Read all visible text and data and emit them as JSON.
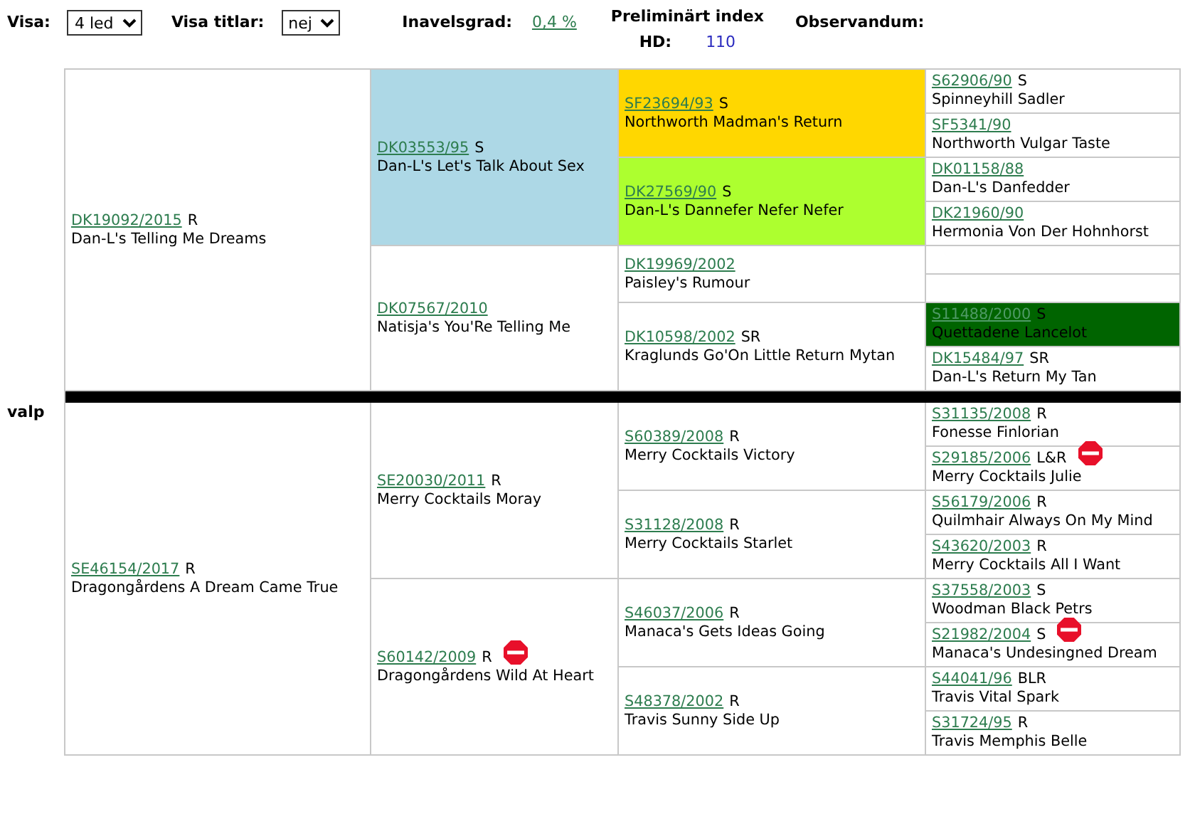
{
  "toolbar": {
    "show_label": "Visa:",
    "show_value": "4 led",
    "titles_label": "Visa titlar:",
    "titles_value": "nej",
    "inbreeding_label": "Inavelsgrad:",
    "inbreeding_value": "0,4 %",
    "index_label": "Preliminärt index",
    "hd_label": "HD:",
    "hd_value": "110",
    "observandum_label": "Observandum:"
  },
  "pedigree": {
    "label": "valp",
    "halves": [
      {
        "kind": "dog",
        "reg": "DK19092/2015",
        "title": "R",
        "name": "Dan-L's Telling Me Dreams",
        "stop": false,
        "children": [
          {
            "kind": "dog",
            "reg": "DK03553/95",
            "title": "S",
            "name": "Dan-L's Let's Talk About Sex",
            "stop": false,
            "color": "#add8e6",
            "children": [
              {
                "kind": "dog",
                "reg": "SF23694/93",
                "title": "S",
                "name": "Northworth Madman's Return",
                "stop": false,
                "color": "#ffd700",
                "children": [
                  {
                    "kind": "dog",
                    "reg": "S62906/90",
                    "title": "S",
                    "name": "Spinneyhill Sadler",
                    "stop": false
                  },
                  {
                    "kind": "dog",
                    "reg": "SF5341/90",
                    "name": "Northworth Vulgar Taste",
                    "stop": false
                  }
                ]
              },
              {
                "kind": "dog",
                "reg": "DK27569/90",
                "title": "S",
                "name": "Dan-L's Dannefer Nefer Nefer",
                "stop": false,
                "color": "#adff2f",
                "children": [
                  {
                    "kind": "dog",
                    "reg": "DK01158/88",
                    "name": "Dan-L's Danfedder",
                    "stop": false
                  },
                  {
                    "kind": "dog",
                    "reg": "DK21960/90",
                    "name": "Hermonia Von Der Hohnhorst",
                    "stop": false
                  }
                ]
              }
            ]
          },
          {
            "kind": "dog",
            "reg": "DK07567/2010",
            "name": "Natisja's You'Re Telling Me",
            "stop": false,
            "children": [
              {
                "kind": "dog",
                "reg": "DK19969/2002",
                "name": "Paisley's Rumour",
                "stop": false,
                "children": [
                  {
                    "kind": "empty"
                  },
                  {
                    "kind": "empty"
                  }
                ]
              },
              {
                "kind": "dog",
                "reg": "DK10598/2002",
                "title": "SR",
                "name": "Kraglunds Go'On Little Return Mytan",
                "stop": false,
                "children": [
                  {
                    "kind": "dog",
                    "reg": "S11488/2000",
                    "title": "S",
                    "name": "Quettadene Lancelot",
                    "stop": false,
                    "color": "#006400"
                  },
                  {
                    "kind": "dog",
                    "reg": "DK15484/97",
                    "title": "SR",
                    "name": "Dan-L's Return My Tan",
                    "stop": false
                  }
                ]
              }
            ]
          }
        ]
      },
      {
        "kind": "dog",
        "reg": "SE46154/2017",
        "title": "R",
        "name": "Dragongårdens A Dream Came True",
        "stop": false,
        "children": [
          {
            "kind": "dog",
            "reg": "SE20030/2011",
            "title": "R",
            "name": "Merry Cocktails Moray",
            "stop": false,
            "children": [
              {
                "kind": "dog",
                "reg": "S60389/2008",
                "title": "R",
                "name": "Merry Cocktails Victory",
                "stop": false,
                "children": [
                  {
                    "kind": "dog",
                    "reg": "S31135/2008",
                    "title": "R",
                    "name": "Fonesse Finlorian",
                    "stop": false
                  },
                  {
                    "kind": "dog",
                    "reg": "S29185/2006",
                    "title": "L&R",
                    "name": "Merry Cocktails Julie",
                    "stop": true
                  }
                ]
              },
              {
                "kind": "dog",
                "reg": "S31128/2008",
                "title": "R",
                "name": "Merry Cocktails Starlet",
                "stop": false,
                "children": [
                  {
                    "kind": "dog",
                    "reg": "S56179/2006",
                    "title": "R",
                    "name": "Quilmhair Always On My Mind",
                    "stop": false
                  },
                  {
                    "kind": "dog",
                    "reg": "S43620/2003",
                    "title": "R",
                    "name": "Merry Cocktails All I Want",
                    "stop": false
                  }
                ]
              }
            ]
          },
          {
            "kind": "dog",
            "reg": "S60142/2009",
            "title": "R",
            "name": "Dragongårdens Wild At Heart",
            "stop": true,
            "children": [
              {
                "kind": "dog",
                "reg": "S46037/2006",
                "title": "R",
                "name": "Manaca's Gets Ideas Going",
                "stop": false,
                "children": [
                  {
                    "kind": "dog",
                    "reg": "S37558/2003",
                    "title": "S",
                    "name": "Woodman Black Petrs",
                    "stop": false
                  },
                  {
                    "kind": "dog",
                    "reg": "S21982/2004",
                    "title": "S",
                    "name": "Manaca's Undesingned Dream",
                    "stop": true
                  }
                ]
              },
              {
                "kind": "dog",
                "reg": "S48378/2002",
                "title": "R",
                "name": "Travis Sunny Side Up",
                "stop": false,
                "children": [
                  {
                    "kind": "dog",
                    "reg": "S44041/96",
                    "title": "BLR",
                    "name": "Travis Vital Spark",
                    "stop": false
                  },
                  {
                    "kind": "dog",
                    "reg": "S31724/95",
                    "title": "R",
                    "name": "Travis Memphis Belle",
                    "stop": false
                  }
                ]
              }
            ]
          }
        ]
      }
    ]
  }
}
